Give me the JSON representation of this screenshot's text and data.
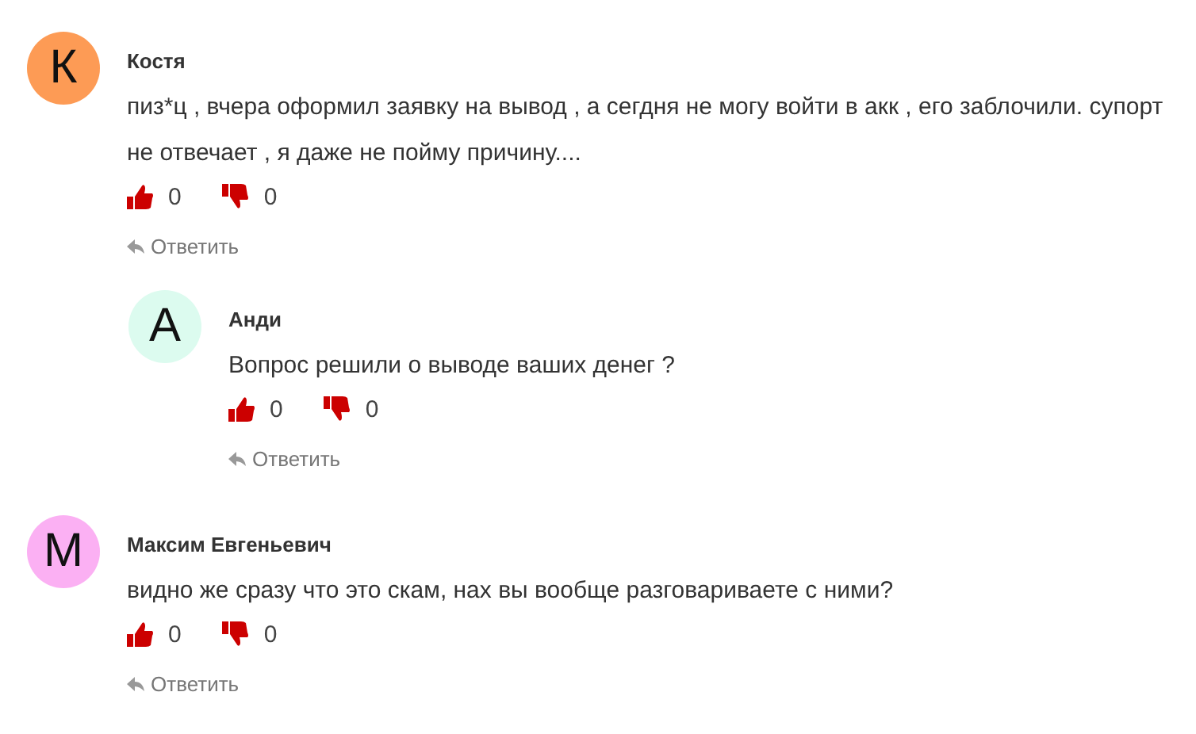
{
  "comments": [
    {
      "author": "Костя",
      "initial": "К",
      "color": "#fd9b55",
      "text": "пиз*ц , вчера оформил заявку на вывод , а сегдня не могу войти в акк , его заблочили. супорт не отвечает , я даже не пойму причину....",
      "likes": "0",
      "dislikes": "0",
      "reply": "Ответить",
      "children": [
        {
          "author": "Анди",
          "initial": "А",
          "color": "#dcfbef",
          "text": "Вопрос решили о выводе ваших денег ?",
          "likes": "0",
          "dislikes": "0",
          "reply": "Ответить"
        }
      ]
    },
    {
      "author": "Максим Евгеньевич",
      "initial": "М",
      "color": "#fbb0f3",
      "text": "видно же сразу что это скам, нах вы вообще разговариваете с ними?",
      "likes": "0",
      "dislikes": "0",
      "reply": "Ответить"
    }
  ]
}
